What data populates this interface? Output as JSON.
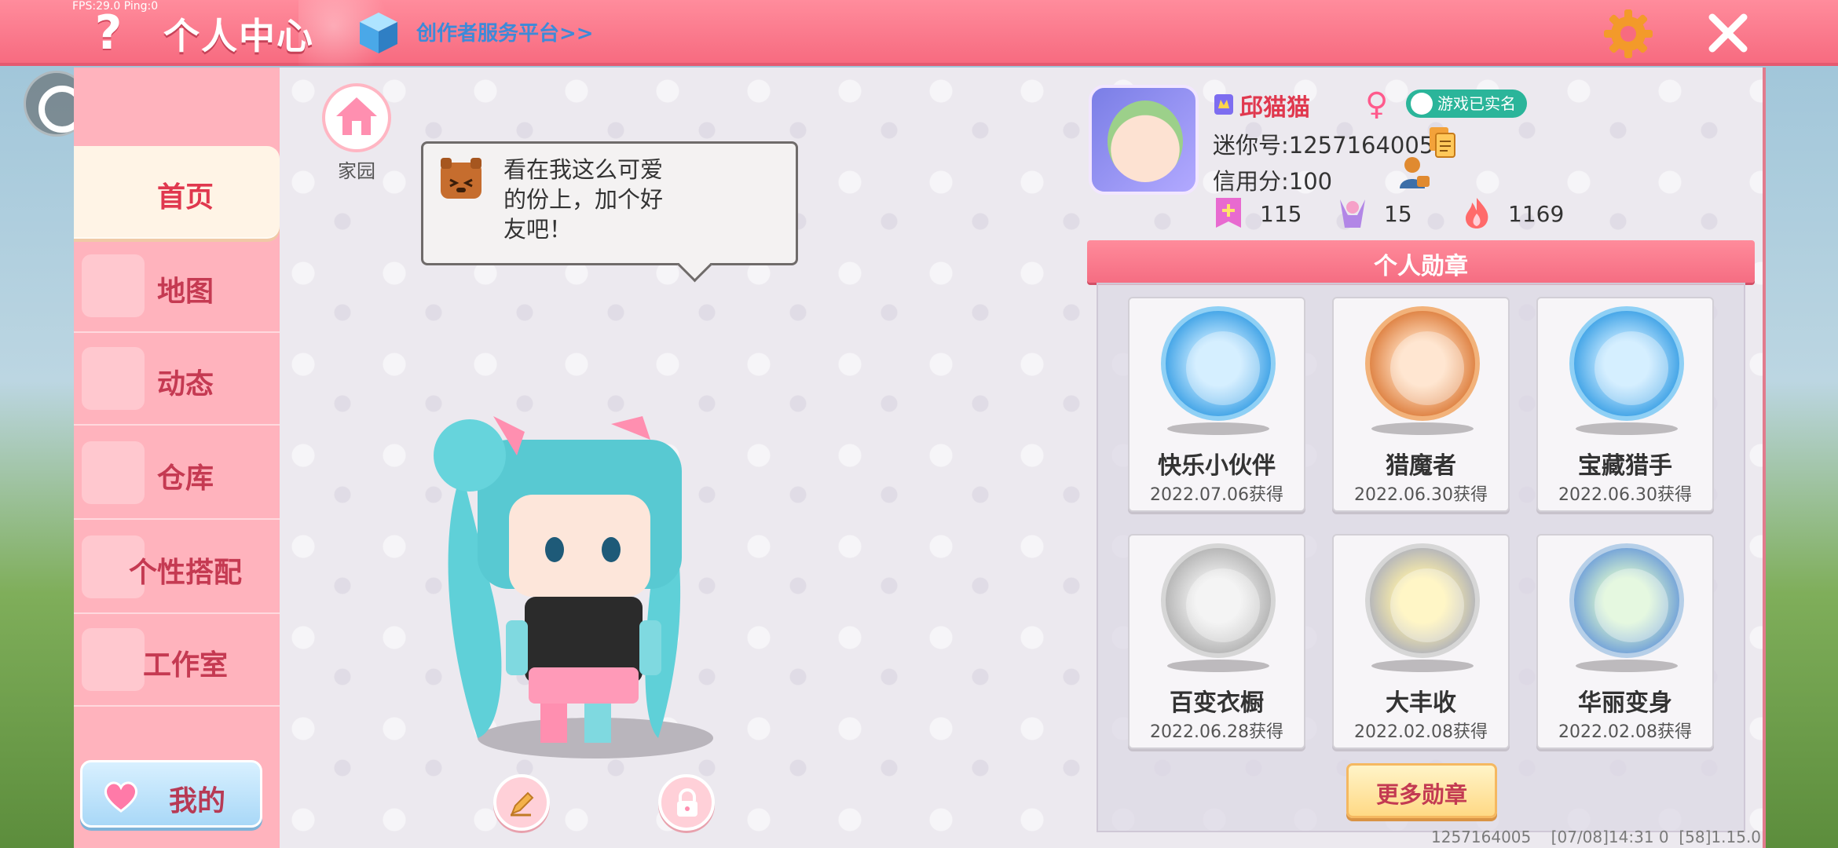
{
  "topbar": {
    "fps": "FPS:29.0 Ping:0",
    "help_icon": "?",
    "title": "个人中心",
    "creator_link": "创作者服务平台>>",
    "icons": [
      "help-icon",
      "cube-icon",
      "gear-icon",
      "close-icon"
    ]
  },
  "sidebar": {
    "items": [
      {
        "label": "首页",
        "active": true
      },
      {
        "label": "地图",
        "active": false
      },
      {
        "label": "动态",
        "active": false
      },
      {
        "label": "仓库",
        "active": false
      },
      {
        "label": "个性搭配",
        "active": false
      },
      {
        "label": "工作室",
        "active": false
      }
    ],
    "mine_label": "我的"
  },
  "main": {
    "home_label": "家园",
    "bubble_text": "看在我这么可爱\n的份上，加个好\n友吧！"
  },
  "profile": {
    "nickname": "邱猫猫",
    "gender_symbol": "♀",
    "verified_label": "游戏已实名",
    "mini_id": "迷你号:1257164005",
    "credit": "信用分:100",
    "stats": [
      {
        "icon": "plus-flag-icon",
        "value": "115"
      },
      {
        "icon": "cheer-icon",
        "value": "15"
      },
      {
        "icon": "flame-icon",
        "value": "1169"
      }
    ]
  },
  "medals": {
    "header": "个人勋章",
    "items": [
      {
        "name": "快乐小伙伴",
        "date": "2022.07.06获得",
        "color": "#4aa8e8"
      },
      {
        "name": "猎魔者",
        "date": "2022.06.30获得",
        "color": "#e0874a"
      },
      {
        "name": "宝藏猎手",
        "date": "2022.06.30获得",
        "color": "#4aa8e8"
      },
      {
        "name": "百变衣橱",
        "date": "2022.06.28获得",
        "color": "#b9b9b9"
      },
      {
        "name": "大丰收",
        "date": "2022.02.08获得",
        "color": "#b9b9b9"
      },
      {
        "name": "华丽变身",
        "date": "2022.02.08获得",
        "color": "#7aa8d8"
      }
    ],
    "more_label": "更多勋章"
  },
  "footer": {
    "info": "1257164005    [07/08]14:31 0  [58]1.15.0"
  },
  "colors": {
    "topbar": "#f76b80",
    "sidebar": "#ffb3bd",
    "accent_red": "#e0384e",
    "panel_bg": "#ece9ef"
  }
}
